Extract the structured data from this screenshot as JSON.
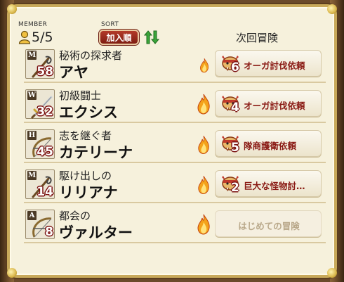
{
  "header": {
    "member_label": "MEMBER",
    "member_count": "5/5",
    "sort_label": "SORT",
    "sort_button": "加入順",
    "next_quest_label": "次回冒険"
  },
  "members": [
    {
      "title": "秘術の探求者",
      "name": "アヤ",
      "job": "M",
      "weapon": "staff",
      "level": "58",
      "flame": "small",
      "quest_icon": "orc-icon",
      "quest_num": "6",
      "quest": "オーガ討伐依頼"
    },
    {
      "title": "初級闘士",
      "name": "エクシス",
      "job": "W",
      "weapon": "sword",
      "level": "32",
      "flame": "large",
      "quest_icon": "orc-icon",
      "quest_num": "4",
      "quest": "オーガ討伐依頼"
    },
    {
      "title": "志を継ぐ者",
      "name": "カテリーナ",
      "job": "H",
      "weapon": "bow",
      "level": "45",
      "flame": "medium",
      "quest_icon": "orc-icon",
      "quest_num": "5",
      "quest": "隊商護衛依頼"
    },
    {
      "title": "駆け出しの",
      "name": "リリアナ",
      "job": "M",
      "weapon": "staff",
      "level": "14",
      "flame": "medium",
      "quest_icon": "orc-icon",
      "quest_num": "2",
      "quest": "巨大な怪物討…"
    },
    {
      "title": "都会の",
      "name": "ヴァルター",
      "job": "A",
      "weapon": "bow",
      "level": "8",
      "flame": "large",
      "quest_icon": "",
      "quest_num": "",
      "quest": "はじめての冒険"
    }
  ],
  "colors": {
    "panel_bg": "#f6f1dc",
    "frame_gold": "#c8a95a",
    "sort_button": "#9e2c1e",
    "quest_text": "#8a1a14",
    "level_outline": "#7a1010",
    "toggle_green": "#3aa53a"
  }
}
